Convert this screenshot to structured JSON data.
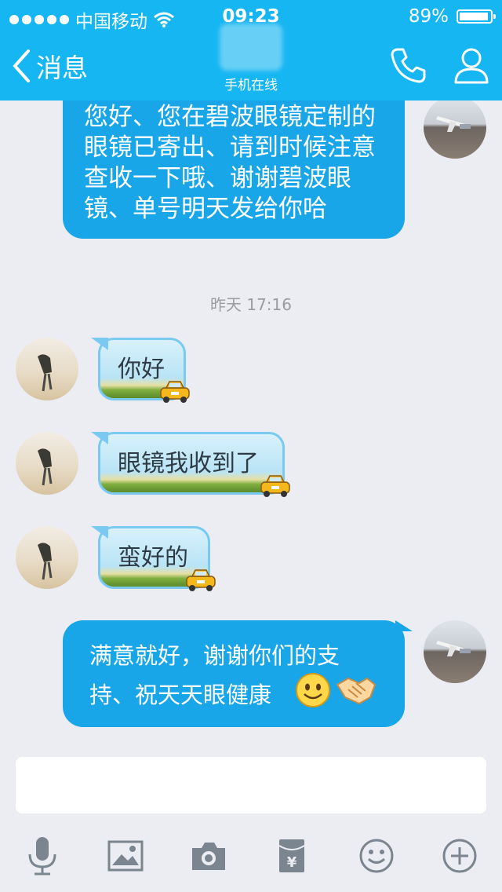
{
  "status_bar": {
    "carrier": "中国移动",
    "time": "09:23",
    "battery": "89%"
  },
  "header": {
    "back_label": "消息",
    "subtitle": "手机在线"
  },
  "messages": [
    {
      "side": "out",
      "text": "您好、您在碧波眼镜定制的眼镜已寄出、请到时候注意查收一下哦、谢谢碧波眼镜、单号明天发给你哈"
    },
    {
      "timestamp": "昨天 17:16"
    },
    {
      "side": "in",
      "text": "你好"
    },
    {
      "side": "in",
      "text": "眼镜我收到了"
    },
    {
      "side": "in",
      "text": "蛮好的"
    },
    {
      "side": "out",
      "text": "满意就好，谢谢你们的支持、祝天天眼健康"
    }
  ],
  "toolbar": {
    "icons": [
      "microphone-icon",
      "image-icon",
      "camera-icon",
      "red-packet-icon",
      "emoji-icon",
      "plus-icon"
    ]
  },
  "colors": {
    "header": "#16b6f2",
    "out_bubble": "#18a6e9",
    "background": "#ebedf2"
  }
}
